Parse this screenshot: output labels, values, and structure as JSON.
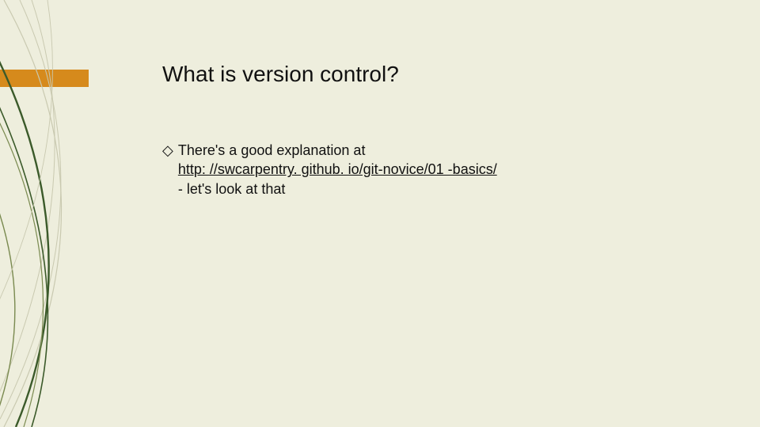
{
  "title": "What is version control?",
  "bullet": {
    "marker": "◇",
    "line1": "There's a good explanation at",
    "link_text": "http: //swcarpentry. github. io/git-novice/01 -basics/",
    "line3": "- let's look at that"
  },
  "colors": {
    "background": "#eeeedd",
    "accent": "#d68a1c",
    "text": "#111111"
  }
}
